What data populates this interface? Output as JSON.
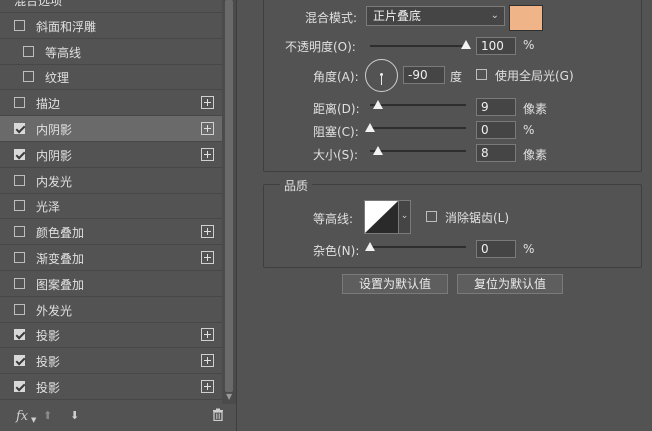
{
  "styles_list": {
    "items": [
      {
        "label": "混合选项",
        "checked": null,
        "plus": false,
        "indent": false,
        "active": false
      },
      {
        "label": "斜面和浮雕",
        "checked": false,
        "plus": false,
        "indent": false,
        "active": false
      },
      {
        "label": "等高线",
        "checked": false,
        "plus": false,
        "indent": true,
        "active": false
      },
      {
        "label": "纹理",
        "checked": false,
        "plus": false,
        "indent": true,
        "active": false
      },
      {
        "label": "描边",
        "checked": false,
        "plus": true,
        "indent": false,
        "active": false
      },
      {
        "label": "内阴影",
        "checked": true,
        "plus": true,
        "indent": false,
        "active": true
      },
      {
        "label": "内阴影",
        "checked": true,
        "plus": true,
        "indent": false,
        "active": false
      },
      {
        "label": "内发光",
        "checked": false,
        "plus": false,
        "indent": false,
        "active": false
      },
      {
        "label": "光泽",
        "checked": false,
        "plus": false,
        "indent": false,
        "active": false
      },
      {
        "label": "颜色叠加",
        "checked": false,
        "plus": true,
        "indent": false,
        "active": false
      },
      {
        "label": "渐变叠加",
        "checked": false,
        "plus": true,
        "indent": false,
        "active": false
      },
      {
        "label": "图案叠加",
        "checked": false,
        "plus": false,
        "indent": false,
        "active": false
      },
      {
        "label": "外发光",
        "checked": false,
        "plus": false,
        "indent": false,
        "active": false
      },
      {
        "label": "投影",
        "checked": true,
        "plus": true,
        "indent": false,
        "active": false
      },
      {
        "label": "投影",
        "checked": true,
        "plus": true,
        "indent": false,
        "active": false
      },
      {
        "label": "投影",
        "checked": true,
        "plus": true,
        "indent": false,
        "active": false
      }
    ],
    "footer": {
      "fx": "fx",
      "icons": [
        "fx-menu-icon",
        "move-up-icon",
        "move-down-icon",
        "trash-icon"
      ]
    }
  },
  "structure": {
    "blend_mode_label": "混合模式:",
    "blend_mode_value": "正片叠底",
    "shadow_color": "#f0b489",
    "opacity_label": "不透明度(O):",
    "opacity_value": "100",
    "opacity_unit": "%",
    "opacity_fraction": 1.0,
    "angle_label": "角度(A):",
    "angle_value": "-90",
    "angle_unit": "度",
    "global_light_label": "使用全局光(G)",
    "global_light_checked": false,
    "distance_label": "距离(D):",
    "distance_value": "9",
    "distance_unit": "像素",
    "choke_label": "阻塞(C):",
    "choke_value": "0",
    "choke_unit": "%",
    "size_label": "大小(S):",
    "size_value": "8",
    "size_unit": "像素"
  },
  "quality": {
    "title": "品质",
    "contour_label": "等高线:",
    "anti_alias_label": "消除锯齿(L)",
    "anti_alias_checked": false,
    "noise_label": "杂色(N):",
    "noise_value": "0",
    "noise_unit": "%"
  },
  "buttons": {
    "set_default": "设置为默认值",
    "reset_default": "复位为默认值"
  },
  "colors": {
    "panel": "#535353",
    "field": "#454545",
    "active_row": "#6a6a6a"
  }
}
